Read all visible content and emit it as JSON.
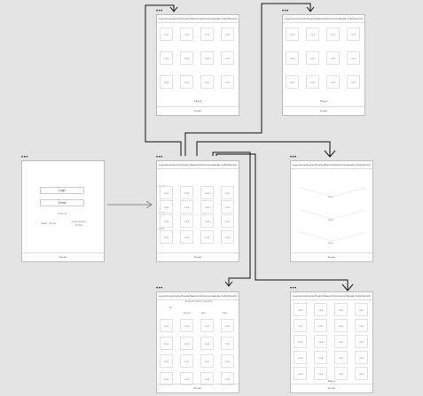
{
  "diagram": {
    "dots": "•••"
  },
  "nav": [
    "Logo",
    "Home",
    "Events",
    "People",
    "Natural Histories",
    "Graduate Jobs",
    "Reports"
  ],
  "login": {
    "logo": "Login",
    "field_1": "Email",
    "field_2": "Write id",
    "link_left": "Make Yourse",
    "link_right": "Organisation Profile"
  },
  "footer": "Footer",
  "paginate": "Pages",
  "card_label": "Card",
  "section_labels": [
    "Section",
    "Group",
    "Panel"
  ],
  "detail_header": "Natural History Record",
  "filters": [
    "All",
    "Sort by",
    "Filter",
    "Date"
  ]
}
